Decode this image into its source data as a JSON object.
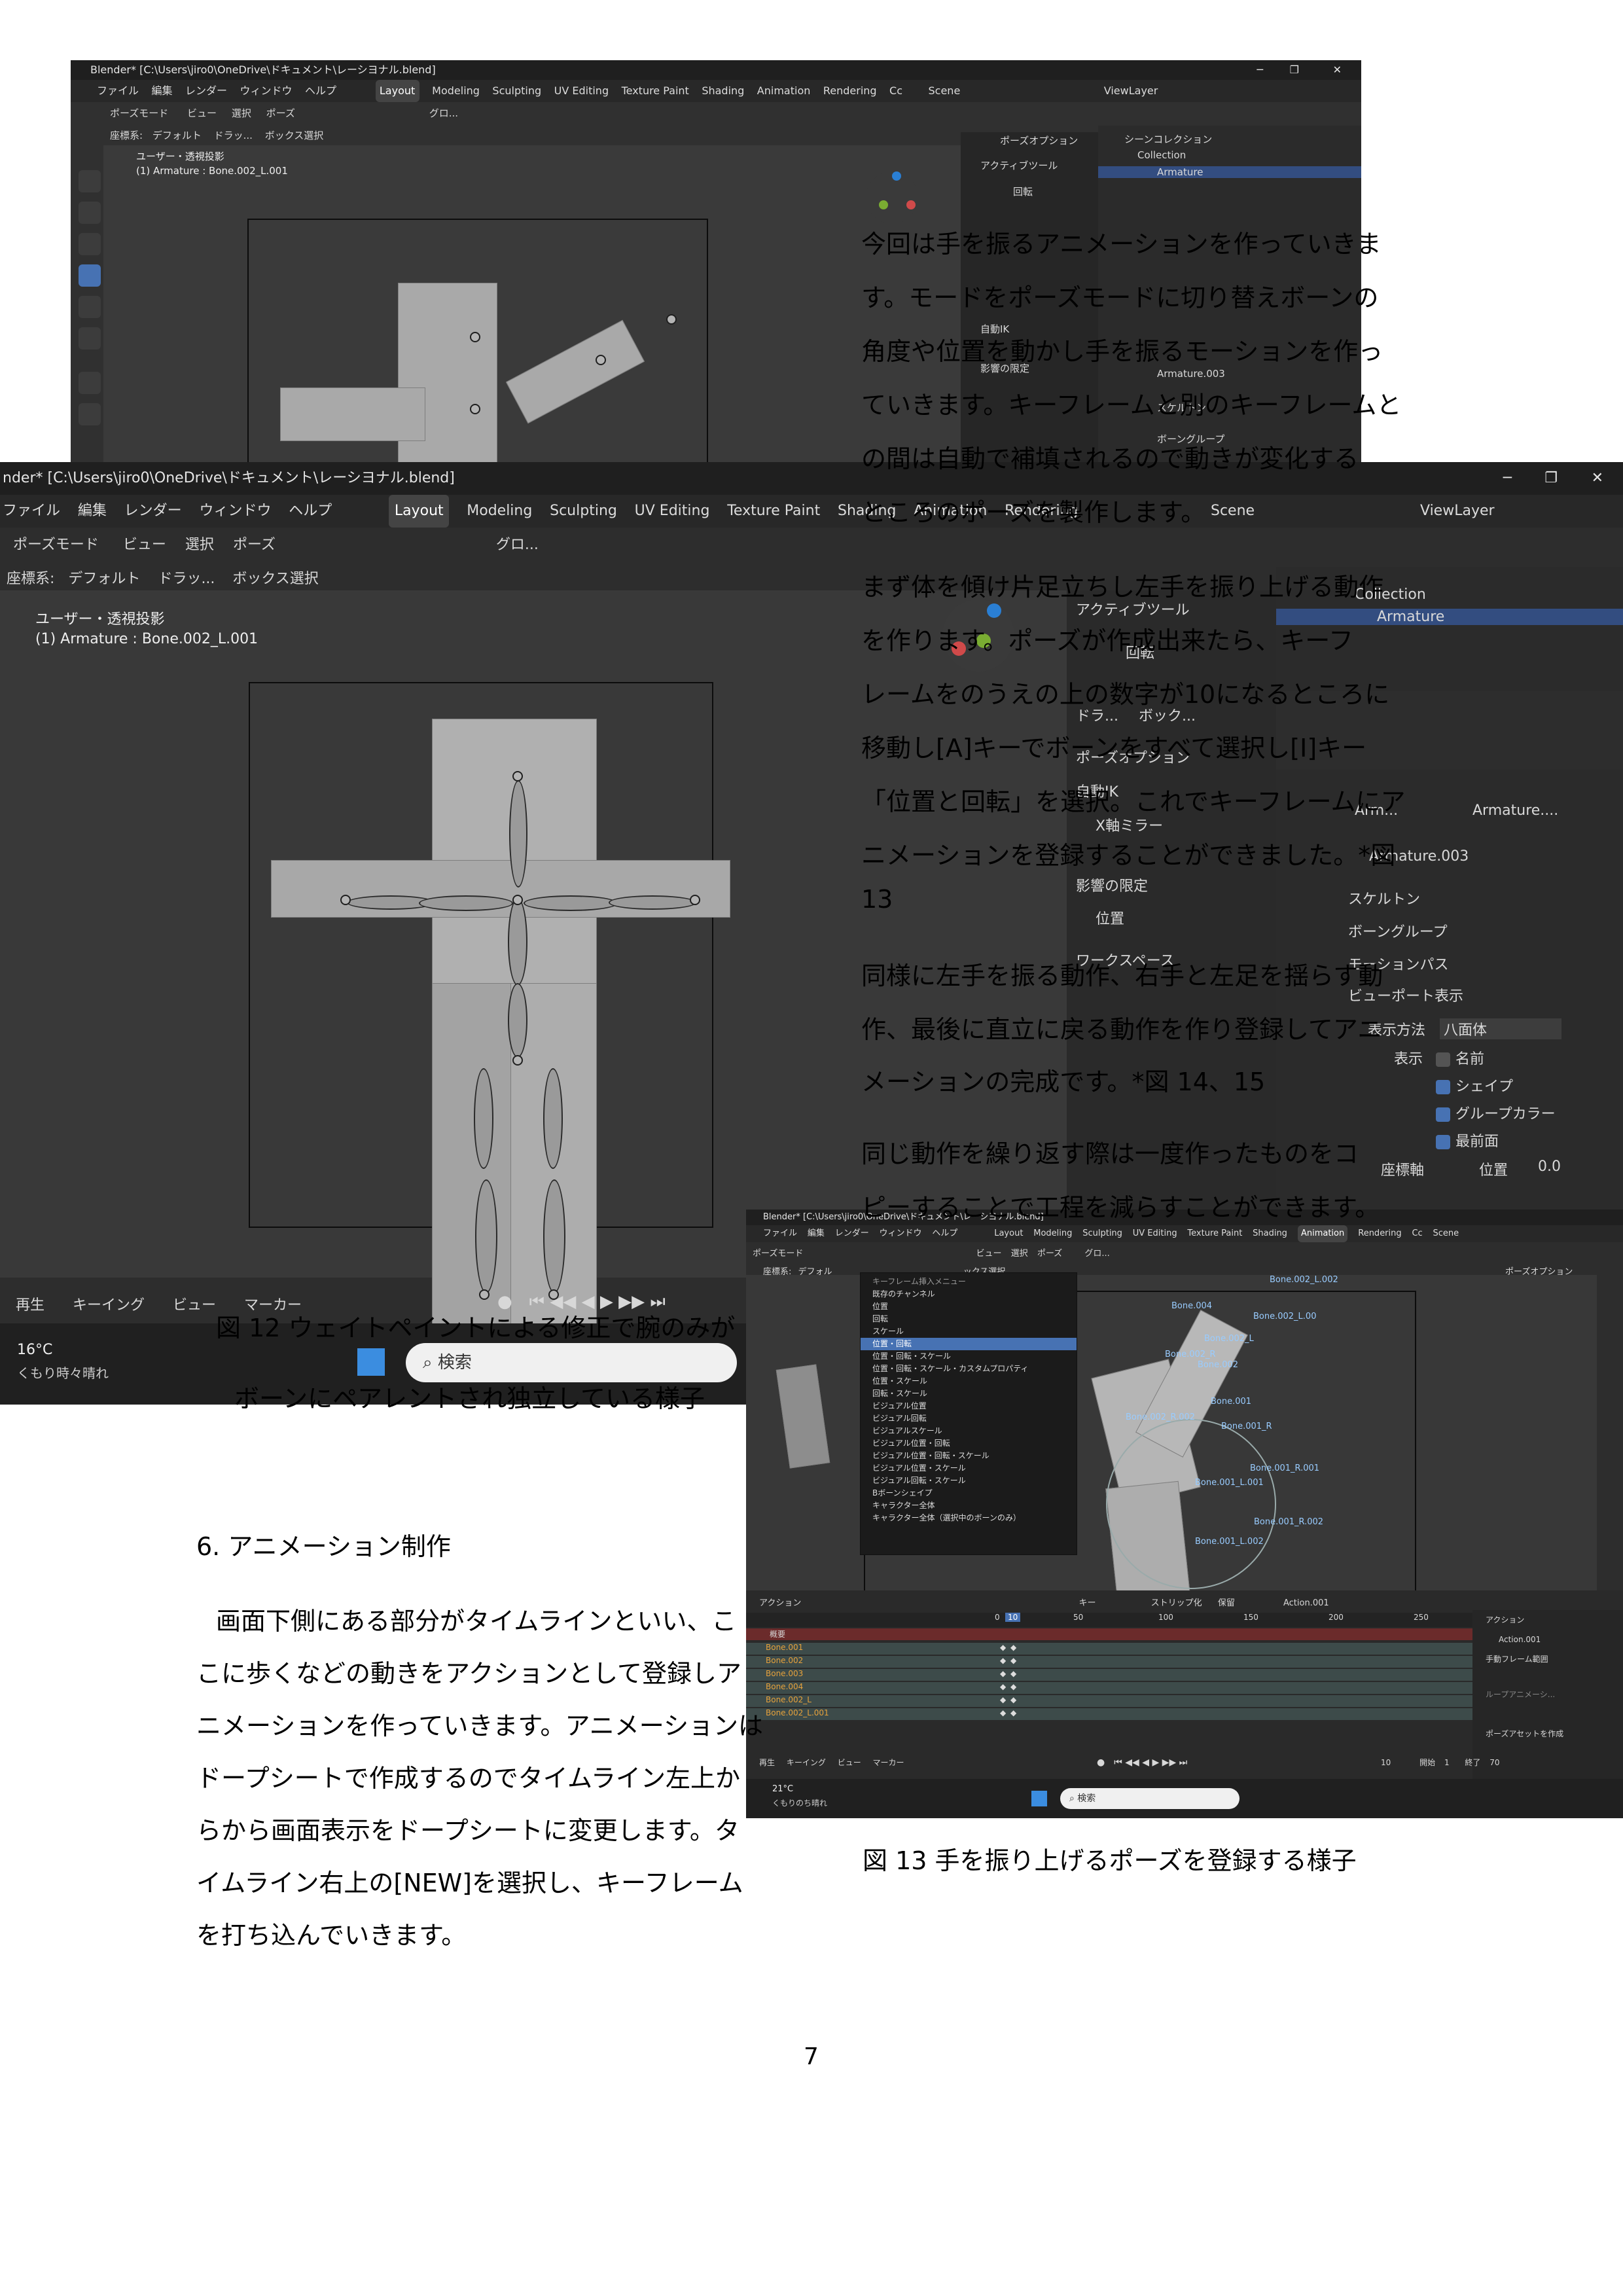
{
  "shot1": {
    "title": "Blender* [C:\\Users\\jiro0\\OneDrive\\ドキュメント\\レーシヨナル.blend]",
    "menus": [
      "ファイル",
      "編集",
      "レンダー",
      "ウィンドウ",
      "ヘルプ"
    ],
    "workspaces": [
      "Layout",
      "Modeling",
      "Sculpting",
      "UV Editing",
      "Texture Paint",
      "Shading",
      "Animation",
      "Rendering",
      "Cc"
    ],
    "scene": "Scene",
    "viewlayer": "ViewLayer",
    "mode": "ポーズモード",
    "header_menus": [
      "ビュー",
      "選択",
      "ポーズ"
    ],
    "coord_label": "座標系:",
    "coord_value": "デフォルト",
    "drag_label": "ドラッ...",
    "drag_value": "ボックス選択",
    "transform": "グロ...",
    "view_name": "ユーザー・透視投影",
    "active_obj": "(1) Armature : Bone.002_L.001",
    "pose_options": "ポーズオプション",
    "active_tool": "アクティブツール",
    "rotate": "回転",
    "auto_ik": "自動IK",
    "limit": "影響の限定",
    "scene_collection": "シーンコレクション",
    "collection": "Collection",
    "armature": "Armature",
    "armature_data": "Armature.003",
    "skeleton": "スケルトン",
    "bone_groups": "ボーングループ"
  },
  "shot2": {
    "title": "nder* [C:\\Users\\jiro0\\OneDrive\\ドキュメント\\レーシヨナル.blend]",
    "menus": [
      "ファイル",
      "編集",
      "レンダー",
      "ウィンドウ",
      "ヘルプ"
    ],
    "workspaces": [
      "Layout",
      "Modeling",
      "Sculpting",
      "UV Editing",
      "Texture Paint",
      "Shading",
      "Animation",
      "Rendering"
    ],
    "scene": "Scene",
    "viewlayer": "ViewLayer",
    "mode": "ポーズモード",
    "header_menus": [
      "ビュー",
      "選択",
      "ポーズ"
    ],
    "coord_label": "座標系:",
    "coord_value": "デフォルト",
    "drag_label": "ドラッ...",
    "drag_value": "ボックス選択",
    "transform": "グロ...",
    "view_name": "ユーザー・透視投影",
    "active_obj": "(1) Armature : Bone.002_L.001",
    "active_tool": "アクティブツール",
    "rotate": "回転",
    "drag2": "ドラ...",
    "box2": "ボック...",
    "pose_options": "ポーズオプション",
    "auto_ik": "自動IK",
    "x_mirror": "X軸ミラー",
    "limit": "影響の限定",
    "position": "位置",
    "workspace": "ワークスペース",
    "collection": "Collection",
    "armature": "Armature",
    "breadcrumb1": "Arm...",
    "breadcrumb2": "Armature....",
    "armature_data": "Armature.003",
    "skeleton": "スケルトン",
    "bone_groups": "ボーングループ",
    "motion_path": "モーションパス",
    "viewport_display": "ビューポート表示",
    "display_as_label": "表示方法",
    "display_as_value": "八面体",
    "show_label": "表示",
    "names": "名前",
    "shapes": "シェイプ",
    "group_colors": "グループカラー",
    "in_front": "最前面",
    "axes": "座標軸",
    "axes_pos": "位置",
    "axes_val": "0.0",
    "timeline_items": [
      "再生",
      "キーイング",
      "ビュー",
      "マーカー"
    ],
    "temp": "16°C",
    "weather": "くもり時々晴れ",
    "search": "検索"
  },
  "shot3": {
    "title": "Blender* [C:\\Users\\jiro0\\OneDrive\\ドキュメント\\レーシヨナル.blend]",
    "menus": [
      "ファイル",
      "編集",
      "レンダー",
      "ウィンドウ",
      "ヘルプ"
    ],
    "workspaces": [
      "Layout",
      "Modeling",
      "Sculpting",
      "UV Editing",
      "Texture Paint",
      "Shading",
      "Animation",
      "Rendering",
      "Cc"
    ],
    "scene": "Scene",
    "mode": "ポーズモード",
    "header_menus": [
      "ビュー",
      "選択",
      "ポーズ"
    ],
    "coord_label": "座標系:",
    "coord_value": "デフォル",
    "drag_value": "ックス選択",
    "transform": "グロ...",
    "pose_options": "ポーズオプション",
    "menu_title": "キーフレーム挿入メニュー",
    "menu_items": [
      "既存のチャンネル",
      "位置",
      "回転",
      "スケール",
      "位置・回転",
      "位置・回転・スケール",
      "位置・回転・スケール・カスタムプロパティ",
      "位置・スケール",
      "回転・スケール",
      "ビジュアル位置",
      "ビジュアル回転",
      "ビジュアルスケール",
      "ビジュアル位置・回転",
      "ビジュアル位置・回転・スケール",
      "ビジュアル位置・スケール",
      "ビジュアル回転・スケール",
      "Bボーンシェイプ",
      "キャラクター全体",
      "キャラクター全体（選択中のボーンのみ）"
    ],
    "menu_highlight_index": 4,
    "bone_labels": [
      "Bone.004",
      "Bone.002_L.002",
      "Bone.002_L.00",
      "Bone.002_L",
      "Bone.002_R",
      "Bone.002",
      "Bone.001",
      "Bone.002_R.002",
      "Bone.001_R",
      "Bone.001_R.001",
      "Bone.001_L.001",
      "Bone.001_R.002",
      "Bone.001_L.002"
    ],
    "dope_header": "アクション",
    "dope_key": "キー",
    "dope_strip": "ストリップ化",
    "dope_save": "保留",
    "action_name": "Action.001",
    "summary": "概要",
    "channels": [
      "Bone.001",
      "Bone.002",
      "Bone.003",
      "Bone.004",
      "Bone.002_L",
      "Bone.002_L.001"
    ],
    "frames": [
      "0",
      "10",
      "50",
      "100",
      "150",
      "200",
      "250"
    ],
    "current_frame": "10",
    "side_action": "アクション",
    "side_action_name": "Action.001",
    "manual_range": "手動フレーム範囲",
    "loop": "ループアニメーシ...",
    "pose_asset": "ポーズアセットを作成",
    "timeline_items": [
      "再生",
      "キーイング",
      "ビュー",
      "マーカー"
    ],
    "frame_cur": "10",
    "start_label": "開始",
    "start_val": "1",
    "end_label": "終了",
    "end_val": "70",
    "temp": "21°C",
    "weather": "くもりのち晴れ",
    "search": "検索"
  },
  "text": {
    "right_para1": [
      "今回は手を振るアニメーションを作っていきま",
      "す。モードをポーズモードに切り替えボーンの",
      "角度や位置を動かし手を振るモーションを作っ",
      "ていきます。キーフレームと別のキーフレームと",
      "の間は自動で補填されるので動きが変化する",
      "ところのポーズを製作します。"
    ],
    "right_para2": [
      "まず体を傾け片足立ちし左手を振り上げる動作",
      "を作ります。ポーズが作成出来たら、キーフ",
      "レームをのうえの上の数字が10になるところに",
      "移動し[A]キーでボーンをすべて選択し[I]キー",
      "「位置と回転」を選択。これでキーフレームにア",
      "ニメーションを登録することができました。*図",
      "13"
    ],
    "right_para3": [
      "同様に左手を振る動作、右手と左足を揺らす動",
      "作、最後に直立に戻る動作を作り登録してアニ",
      "メーションの完成です。*図 14、15"
    ],
    "right_para4": [
      "同じ動作を繰り返す際は一度作ったものをコ",
      "ピーすることで工程を減らすことができます。"
    ],
    "caption12_line1": "図 12 ウェイトペイントによる修正で腕のみが",
    "caption12_line2": "ボーンにペアレントされ独立している様子",
    "section_title": "6. アニメーション制作",
    "left_para": [
      "画面下側にある部分がタイムラインといい、こ",
      "こに歩くなどの動きをアクションとして登録しア",
      "ニメーションを作っていきます。アニメーションは",
      "ドープシートで作成するのでタイムライン左上か",
      "らから画面表示をドープシートに変更します。タ",
      "イムライン右上の[NEW]を選択し、キーフレーム",
      "を打ち込んでいきます。"
    ],
    "caption13": "図 13 手を振り上げるポーズを登録する様子",
    "page_number": "7"
  },
  "colors": {
    "blender_bg": "#303030",
    "blender_accent": "#4772b3",
    "orange": "#e6a23c"
  }
}
